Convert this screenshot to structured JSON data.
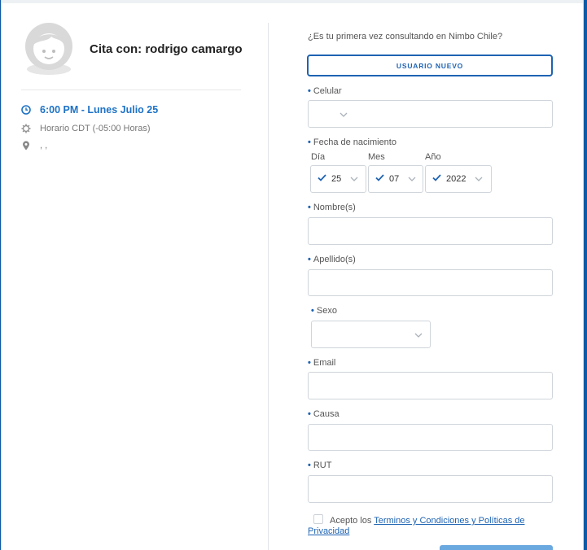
{
  "appointment": {
    "title": "Cita con: rodrigo camargo",
    "time": "6:00 PM - Lunes Julio 25",
    "timezone": "Horario CDT (-05:00 Horas)",
    "location": ", ,"
  },
  "form": {
    "question": "¿Es tu primera vez consultando en Nimbo Chile?",
    "new_user_label": "USUARIO NUEVO",
    "required_mark": "•",
    "fields": {
      "celular": "Celular",
      "fecha": "Fecha de nacimiento",
      "dia": "Día",
      "mes": "Mes",
      "anio": "Año",
      "nombre": "Nombre(s)",
      "apellido": "Apellido(s)",
      "sexo": "Sexo",
      "email": "Email",
      "causa": "Causa",
      "rut": "RUT"
    },
    "birth": {
      "day": "25",
      "month": "07",
      "year": "2022"
    },
    "terms_prefix": "Acepto los",
    "terms_link": "Terminos y Condiciones y Políticas de Privacidad"
  },
  "colors": {
    "accent": "#1e63b3",
    "background": "#0e5aa6"
  },
  "icons": [
    "avatar-icon",
    "clock-icon",
    "gear-icon",
    "location-pin-icon",
    "chevron-down-icon",
    "check-icon"
  ]
}
